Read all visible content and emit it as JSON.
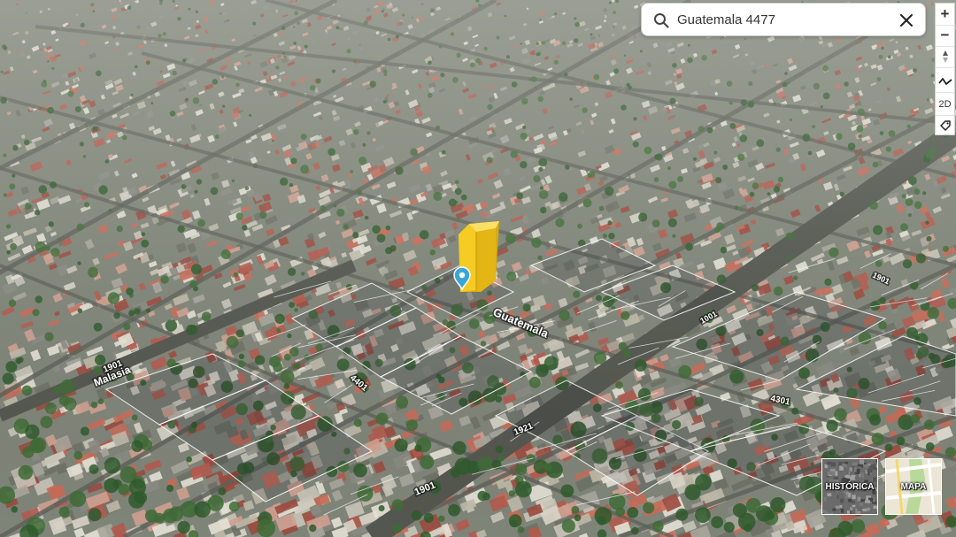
{
  "search": {
    "value": "Guatemala 4477"
  },
  "toolbar": {
    "zoom_in": "+",
    "zoom_out": "−",
    "compass_icon": "compass-arrow",
    "terrain_icon": "terrain-wave",
    "view_mode": "2D",
    "measure_icon": "tag-ruler"
  },
  "street_labels": {
    "guatemala": "Guatemala",
    "malasia": "Malasia",
    "n1901_left": "1901",
    "n1901_bottom": "1901",
    "n4401": "4401",
    "n4301": "4301",
    "n1921": "1921",
    "n1001": "1001",
    "n1901_right": "1901"
  },
  "layers": {
    "historica": "HISTÓRICA",
    "mapa": "MAPA"
  },
  "colors": {
    "selected_building": "#f2c21b",
    "marker": "#3aa6d6",
    "parcel_outline": "#ffffff",
    "vegetation": "#3f6b36",
    "roof_red": "#b85a4a"
  }
}
